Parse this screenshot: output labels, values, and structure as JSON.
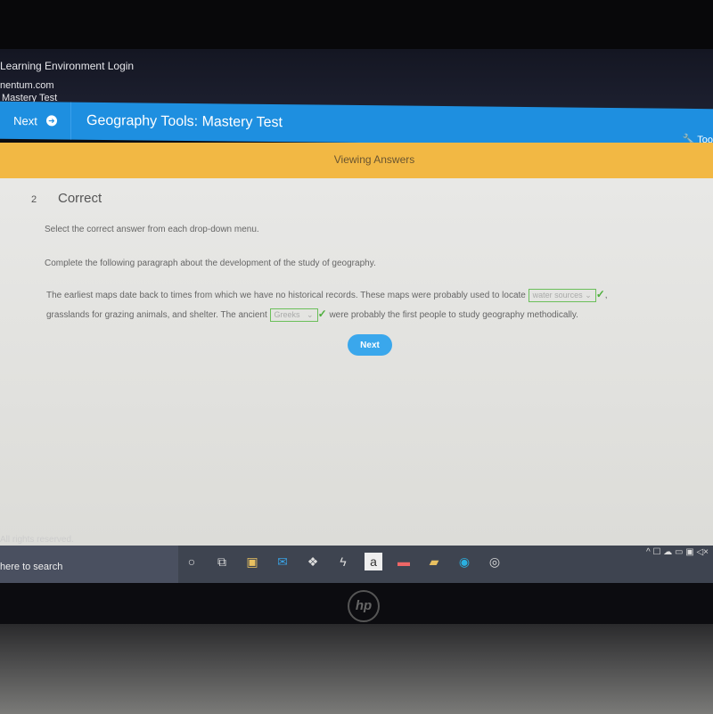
{
  "browser": {
    "tab_title": "Learning Environment Login",
    "url": "nentum.com",
    "tab2": "Mastery Test"
  },
  "header": {
    "next_label": "Next",
    "title": "Geography Tools: Mastery Test",
    "tools_label": "Too"
  },
  "banner": "Viewing Answers",
  "question": {
    "number": "2",
    "status": "Correct",
    "instruction": "Select the correct answer from each drop-down menu.",
    "prompt": "Complete the following paragraph about the development of the study of geography.",
    "text1": "The earliest maps date back to times from which we have no historical records. These maps were probably used to locate",
    "dropdown1": "water sources",
    "text2": "grasslands for grazing animals, and shelter. The ancient",
    "dropdown2": "Greeks",
    "text3": "were probably the first people to study geography methodically.",
    "next_label": "Next"
  },
  "footer": "All rights reserved.",
  "taskbar": {
    "search_placeholder": "here to search"
  },
  "colors": {
    "header": "#1e8fe0",
    "banner": "#f2b844",
    "correct": "#4cae3a"
  }
}
